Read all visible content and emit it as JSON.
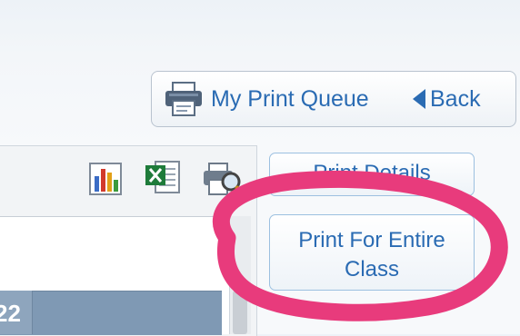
{
  "toolbar": {
    "print_queue_label": "My Print Queue",
    "back_label": "Back"
  },
  "icons": {
    "printer": "printer-icon",
    "back": "back-arrow-icon",
    "chart": "bar-chart-icon",
    "excel": "excel-icon",
    "preview": "print-preview-icon"
  },
  "actions": {
    "print_details_label": "Print Details",
    "print_entire_class_line1": "Print For Entire",
    "print_entire_class_line2": "Class"
  },
  "grid": {
    "visible_header_cell": "22"
  },
  "colors": {
    "link_blue": "#2a6bb3",
    "highlight": "#e83b7c",
    "grid_header": "#7f99b4"
  }
}
